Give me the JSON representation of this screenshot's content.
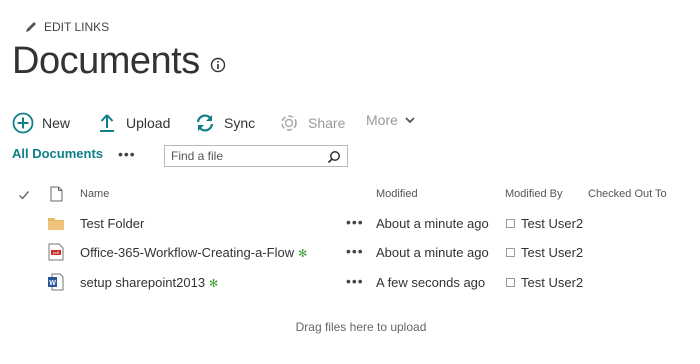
{
  "header": {
    "edit_links": "EDIT LINKS",
    "title": "Documents"
  },
  "commands": {
    "new": "New",
    "upload": "Upload",
    "sync": "Sync",
    "share": "Share",
    "more": "More"
  },
  "view": {
    "current": "All Documents",
    "more_dots": "•••",
    "search_placeholder": "Find a file"
  },
  "columns": {
    "name": "Name",
    "modified": "Modified",
    "modified_by": "Modified By",
    "checked_out_to": "Checked Out To"
  },
  "rows": [
    {
      "type": "folder",
      "icon": "folder-icon",
      "name": "Test Folder",
      "is_new": false,
      "modified": "About a minute ago",
      "modified_by": "Test User2"
    },
    {
      "type": "pdf",
      "icon": "pdf-file-icon",
      "name": "Office-365-Workflow-Creating-a-Flow",
      "is_new": true,
      "modified": "About a minute ago",
      "modified_by": "Test User2"
    },
    {
      "type": "word",
      "icon": "word-file-icon",
      "name": "setup sharepoint2013",
      "is_new": true,
      "modified": "A few seconds ago",
      "modified_by": "Test User2"
    }
  ],
  "new_marker": "✻",
  "row_dots": "•••",
  "drag_hint": "Drag files here to upload",
  "colors": {
    "accent": "#0f7f88",
    "new_marker": "#3c9b2f",
    "folder": "#e8b769"
  }
}
